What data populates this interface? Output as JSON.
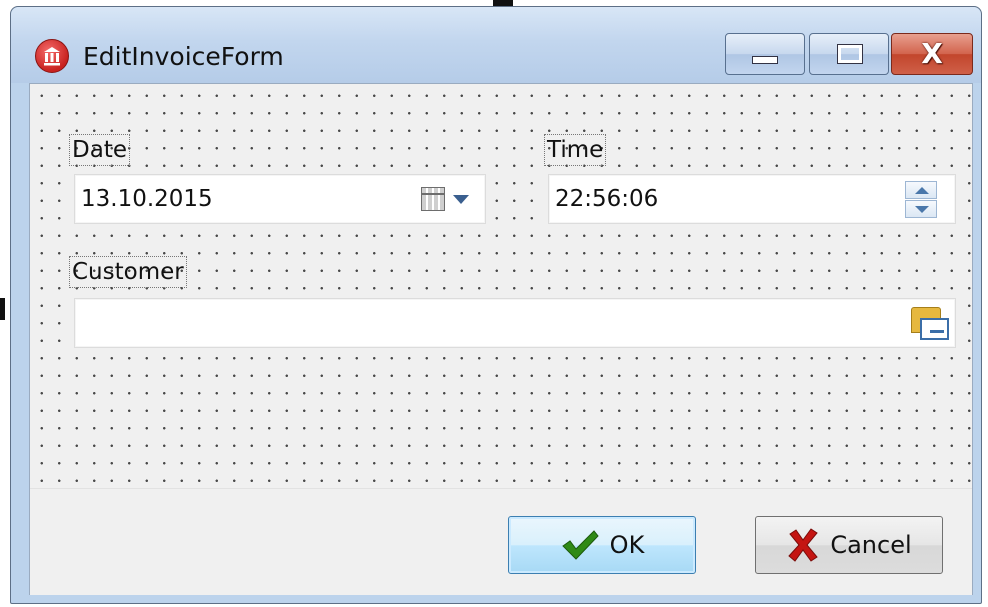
{
  "window": {
    "title": "EditInvoiceForm",
    "controls": {
      "minimize": "minimize",
      "maximize": "maximize",
      "close": "X"
    }
  },
  "form": {
    "date": {
      "label": "Date",
      "value": "13.10.2015"
    },
    "time": {
      "label": "Time",
      "value": "22:56:06"
    },
    "customer": {
      "label": "Customer",
      "value": ""
    }
  },
  "buttons": {
    "ok": "OK",
    "cancel": "Cancel"
  },
  "icons": {
    "app": "bank-icon",
    "date_picker": "calendar-dropdown-icon",
    "time_spinner": "spin-up-down-icon",
    "customer_lookup": "folder-card-icon",
    "ok": "green-check-icon",
    "cancel": "red-x-icon"
  },
  "colors": {
    "ok_check": "#2f8a16",
    "cancel_x": "#c41512",
    "app_icon": "#c8221f"
  }
}
